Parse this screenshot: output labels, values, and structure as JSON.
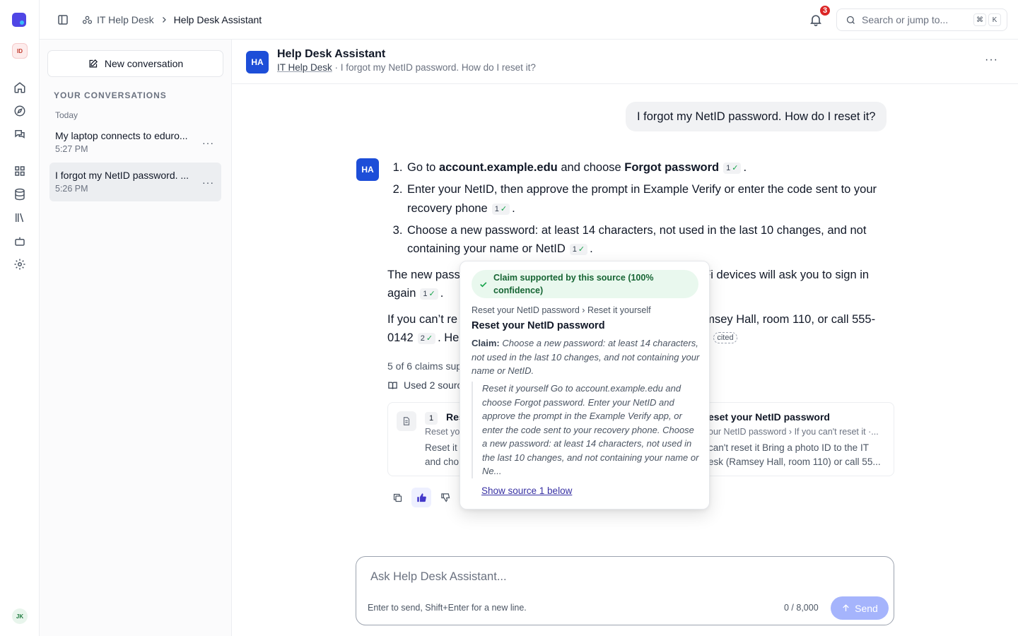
{
  "rail": {
    "workspace_initials": "ID",
    "user_initials": "JK",
    "icons": [
      "home-icon",
      "compass-icon",
      "chat-icon",
      "grid-icon",
      "database-icon",
      "library-icon",
      "bot-icon",
      "gear-icon"
    ]
  },
  "topbar": {
    "breadcrumb": [
      "IT Help Desk",
      "Help Desk Assistant"
    ],
    "notifications": "3",
    "search_placeholder": "Search or jump to...",
    "shortcut": [
      "⌘",
      "K"
    ]
  },
  "sidebar": {
    "new_button": "New conversation",
    "section": "YOUR CONVERSATIONS",
    "group": "Today",
    "conversations": [
      {
        "title": "My laptop connects to eduro...",
        "time": "5:27 PM",
        "active": false
      },
      {
        "title": "I forgot my NetID password. ...",
        "time": "5:26 PM",
        "active": true
      }
    ]
  },
  "chat": {
    "assistant_name": "Help Desk Assistant",
    "avatar": "HA",
    "workspace": "IT Help Desk",
    "subtitle": "· I forgot my NetID password. How do I reset it?",
    "user_message": "I forgot my NetID password. How do I reset it?",
    "steps": [
      {
        "pre": "Go to ",
        "b1": "account.example.edu",
        "mid": " and choose ",
        "b2": "Forgot password",
        "cite": "1"
      },
      {
        "text": "Enter your NetID, then approve the prompt in Example Verify or enter the code sent to your recovery phone",
        "cite": "1"
      },
      {
        "text": "Choose a new password: at least 14 characters, not used in the last 10 changes, and not containing your name or NetID",
        "cite": "1"
      }
    ],
    "para1": {
      "a": "The new pass",
      "b": "-Fi devices will ask you to sign in again",
      "cite": "1"
    },
    "para2": {
      "a": "If you can’t re",
      "b": "amsey Hall, room 110, or call 555-0142",
      "cite": "2",
      "c": ". He",
      "uncited": "cited"
    },
    "claims_summary": "5 of 6 claims sup",
    "used_sources": "Used 2 sourc",
    "sources": [
      {
        "num": "1",
        "title": "Res",
        "path": "Reset yo",
        "excerpt": "Reset it y\nand cho"
      },
      {
        "title": "eset your NetID password",
        "path": "our NetID password › If you can't reset it ·...",
        "excerpt": "can't reset it Bring a photo ID to the IT\nesk (Ramsey Hall, room 110) or call 55..."
      }
    ]
  },
  "popover": {
    "status": "Claim supported by this source (100% confidence)",
    "path": "Reset your NetID password › Reset it yourself",
    "title": "Reset your NetID password",
    "claim_label": "Claim:",
    "claim": "Choose a new password: at least 14 characters, not used in the last 10 changes, and not containing your name or NetID.",
    "quote": "Reset it yourself Go to account.example.edu and choose Forgot password. Enter your NetID and approve the prompt in the Example Verify app, or enter the code sent to your recovery phone. Choose a new password: at least 14 characters, not used in the last 10 changes, and not containing your name or Ne...",
    "link": "Show source 1 below"
  },
  "composer": {
    "placeholder": "Ask Help Desk Assistant...",
    "hint": "Enter to send, Shift+Enter for a new line.",
    "count": "0 / 8,000",
    "send": "Send"
  }
}
